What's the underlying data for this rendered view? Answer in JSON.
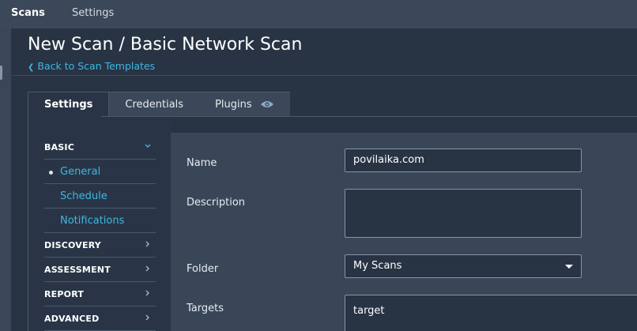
{
  "topbar": {
    "scans": "Scans",
    "settings": "Settings"
  },
  "header": {
    "title": "New Scan / Basic Network Scan",
    "back_link": "Back to Scan Templates"
  },
  "tabs": [
    {
      "label": "Settings",
      "active": true
    },
    {
      "label": "Credentials",
      "active": false
    },
    {
      "label": "Plugins",
      "active": false,
      "icon": "eye-icon"
    }
  ],
  "sidenav": {
    "basic": {
      "label": "BASIC",
      "expanded": true,
      "items": [
        {
          "label": "General",
          "selected": true
        },
        {
          "label": "Schedule",
          "selected": false
        },
        {
          "label": "Notifications",
          "selected": false
        }
      ]
    },
    "discovery": "DISCOVERY",
    "assessment": "ASSESSMENT",
    "report": "REPORT",
    "advanced": "ADVANCED"
  },
  "form": {
    "name_label": "Name",
    "name_value": "povilaika.com",
    "description_label": "Description",
    "description_value": "",
    "folder_label": "Folder",
    "folder_value": "My Scans",
    "targets_label": "Targets",
    "targets_value": "target"
  },
  "colors": {
    "accent": "#3fb7e0",
    "topbar": "#3b4859",
    "background": "#293546",
    "form_panel": "#394657"
  }
}
